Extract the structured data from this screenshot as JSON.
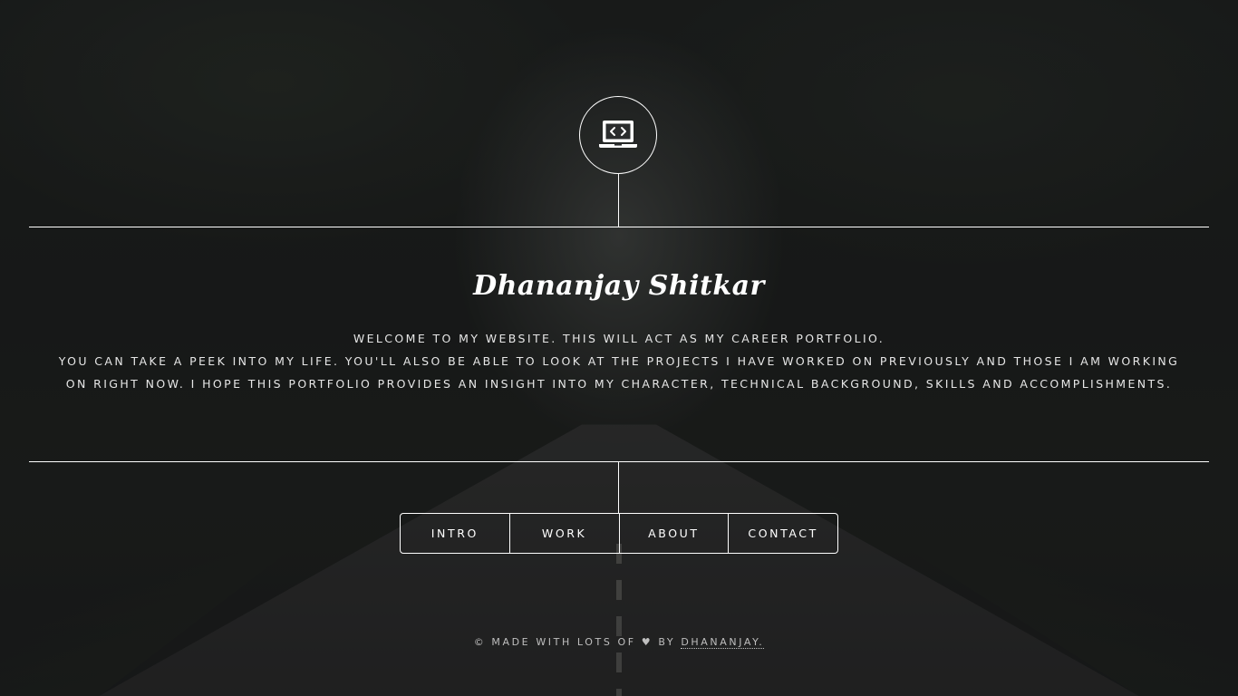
{
  "logo": {
    "icon": "laptop-code-icon"
  },
  "header": {
    "name": "Dhananjay Shitkar",
    "intro_line1": "Welcome to my website. This will act as my career portfolio.",
    "intro_line2": "You can take a peek into my life. You'll also be able to look at the projects I have worked on previously and those I am working on right now. I hope this portfolio provides an insight into my character, technical background, skills and accomplishments."
  },
  "nav": {
    "items": [
      {
        "label": "Intro"
      },
      {
        "label": "Work"
      },
      {
        "label": "About"
      },
      {
        "label": "Contact"
      }
    ]
  },
  "footer": {
    "prefix": "© Made with lots of ♥ by",
    "author": "Dhananjay."
  },
  "colors": {
    "overlay": "#131516",
    "line": "#ffffff",
    "text": "#ffffff"
  }
}
